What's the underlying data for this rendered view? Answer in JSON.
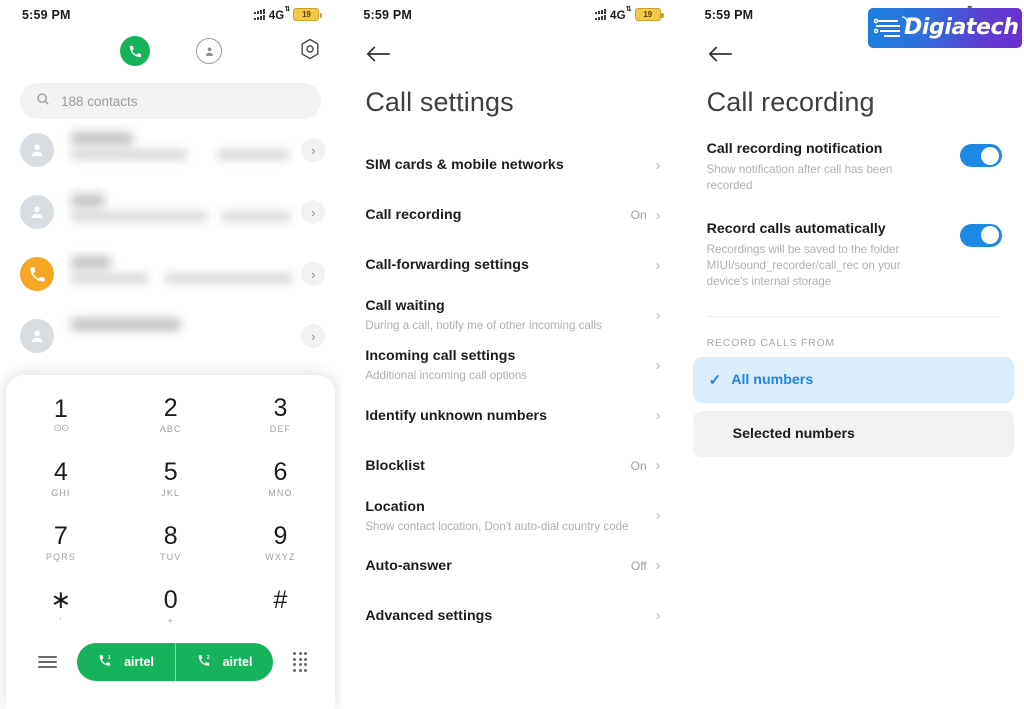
{
  "statusbar": {
    "time": "5:59 PM",
    "network": "4G",
    "battery": "19",
    "signal_icon": "signal-bars-icon",
    "battery_icon": "battery-icon"
  },
  "brand": {
    "logo_text": "Digiatech",
    "logo_gradient_start": "#1b7fe0",
    "logo_gradient_end": "#6a2fcf"
  },
  "theme": {
    "green": "#17b25c",
    "blue": "#1e88e5",
    "selected_bg": "#dbecfb",
    "selected_fg": "#2086e2",
    "plain_bg": "#f2f2f2"
  },
  "dialer": {
    "tabs": [
      {
        "name": "keypad-tab",
        "icon": "phone-icon",
        "active": true
      },
      {
        "name": "contacts-tab",
        "icon": "person-icon",
        "active": false
      },
      {
        "name": "settings-tab",
        "icon": "gear-icon",
        "active": false
      }
    ],
    "search": {
      "icon": "search-icon",
      "placeholder": "188 contacts",
      "value": "188 contacts"
    },
    "contacts": [
      {
        "avatar": "person-icon",
        "avatar_color": "#d8dde2",
        "redacted": true
      },
      {
        "avatar": "person-icon",
        "avatar_color": "#d8dde2",
        "redacted": true
      },
      {
        "avatar": "call-icon",
        "avatar_color": "#f5a623",
        "redacted": true
      },
      {
        "avatar": "person-icon",
        "avatar_color": "#d8dde2",
        "redacted": true
      }
    ],
    "keypad": [
      {
        "digit": "1",
        "sub": "",
        "voicemail": true
      },
      {
        "digit": "2",
        "sub": "ABC"
      },
      {
        "digit": "3",
        "sub": "DEF"
      },
      {
        "digit": "4",
        "sub": "GHI"
      },
      {
        "digit": "5",
        "sub": "JKL"
      },
      {
        "digit": "6",
        "sub": "MNO"
      },
      {
        "digit": "7",
        "sub": "PQRS"
      },
      {
        "digit": "8",
        "sub": "TUV"
      },
      {
        "digit": "9",
        "sub": "WXYZ"
      },
      {
        "digit": "∗",
        "sub": "'"
      },
      {
        "digit": "0",
        "sub": "+"
      },
      {
        "digit": "#",
        "sub": ""
      }
    ],
    "actions": {
      "menu_icon": "hamburger-menu-icon",
      "keypad_icon": "dialpad-grid-icon",
      "call_buttons": [
        {
          "label": "airtel",
          "sim": "1",
          "icon": "call-icon"
        },
        {
          "label": "airtel",
          "sim": "2",
          "icon": "call-icon"
        }
      ]
    }
  },
  "call_settings": {
    "back_icon": "back-arrow-icon",
    "title": "Call settings",
    "items": [
      {
        "title": "SIM cards & mobile networks",
        "sub": "",
        "value": ""
      },
      {
        "title": "Call recording",
        "sub": "",
        "value": "On"
      },
      {
        "title": "Call-forwarding settings",
        "sub": "",
        "value": ""
      },
      {
        "title": "Call waiting",
        "sub": "During a call, notify me of other incoming calls",
        "value": ""
      },
      {
        "title": "Incoming call settings",
        "sub": "Additional incoming call options",
        "value": ""
      },
      {
        "title": "Identify unknown numbers",
        "sub": "",
        "value": ""
      },
      {
        "title": "Blocklist",
        "sub": "",
        "value": "On"
      },
      {
        "title": "Location",
        "sub": "Show contact location, Don't auto-dial country code",
        "value": ""
      },
      {
        "title": "Auto-answer",
        "sub": "",
        "value": "Off"
      },
      {
        "title": "Advanced settings",
        "sub": "",
        "value": ""
      }
    ]
  },
  "call_recording": {
    "back_icon": "back-arrow-icon",
    "title": "Call recording",
    "toggles": [
      {
        "title": "Call recording notification",
        "sub": "Show notification after call has been recorded",
        "on": true
      },
      {
        "title": "Record calls automatically",
        "sub": "Recordings will be saved to the folder MIUI/sound_recorder/call_rec on your device's internal storage",
        "on": true
      }
    ],
    "section_header": "RECORD CALLS FROM",
    "options": [
      {
        "label": "All numbers",
        "selected": true,
        "check_icon": "check-icon"
      },
      {
        "label": "Selected numbers",
        "selected": false
      }
    ]
  }
}
